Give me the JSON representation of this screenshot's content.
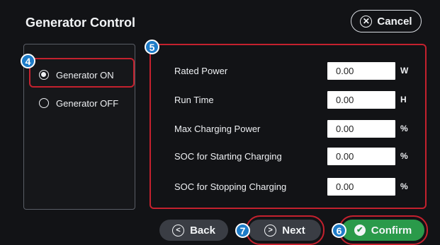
{
  "header": {
    "title": "Generator Control",
    "cancel_label": "Cancel"
  },
  "options": [
    {
      "label": "Generator ON",
      "selected": true
    },
    {
      "label": "Generator OFF",
      "selected": false
    }
  ],
  "fields": [
    {
      "label": "Rated Power",
      "value": "0.00",
      "unit": "W"
    },
    {
      "label": "Run Time",
      "value": "0.00",
      "unit": "H"
    },
    {
      "label": "Max Charging Power",
      "value": "0.00",
      "unit": "%"
    },
    {
      "label": "SOC for Starting Charging",
      "value": "0.00",
      "unit": "%"
    },
    {
      "label": "SOC for Stopping Charging",
      "value": "0.00",
      "unit": "%"
    }
  ],
  "footer": {
    "back_label": "Back",
    "next_label": "Next",
    "confirm_label": "Confirm"
  },
  "badges": {
    "options": "4",
    "fields": "5",
    "confirm": "6",
    "next": "7"
  },
  "colors": {
    "background": "#121316",
    "highlight": "#c4212e",
    "badge": "#1e7cc8",
    "confirm": "#2a9a4a",
    "button": "#3a3d44"
  }
}
